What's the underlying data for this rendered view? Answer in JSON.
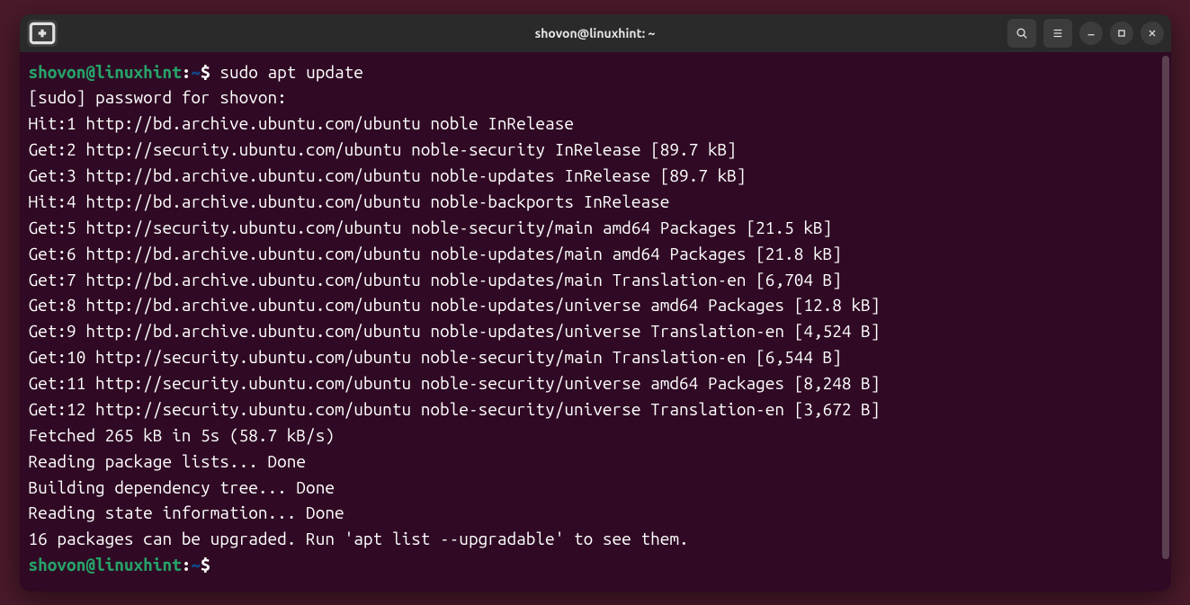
{
  "title": "shovon@linuxhint: ~",
  "prompt": {
    "user_host": "shovon@linuxhint",
    "colon": ":",
    "path": "~",
    "sep": "$"
  },
  "command": "sudo apt update",
  "output": [
    "[sudo] password for shovon:",
    "Hit:1 http://bd.archive.ubuntu.com/ubuntu noble InRelease",
    "Get:2 http://security.ubuntu.com/ubuntu noble-security InRelease [89.7 kB]",
    "Get:3 http://bd.archive.ubuntu.com/ubuntu noble-updates InRelease [89.7 kB]",
    "Hit:4 http://bd.archive.ubuntu.com/ubuntu noble-backports InRelease",
    "Get:5 http://security.ubuntu.com/ubuntu noble-security/main amd64 Packages [21.5 kB]",
    "Get:6 http://bd.archive.ubuntu.com/ubuntu noble-updates/main amd64 Packages [21.8 kB]",
    "Get:7 http://bd.archive.ubuntu.com/ubuntu noble-updates/main Translation-en [6,704 B]",
    "Get:8 http://bd.archive.ubuntu.com/ubuntu noble-updates/universe amd64 Packages [12.8 kB]",
    "Get:9 http://bd.archive.ubuntu.com/ubuntu noble-updates/universe Translation-en [4,524 B]",
    "Get:10 http://security.ubuntu.com/ubuntu noble-security/main Translation-en [6,544 B]",
    "Get:11 http://security.ubuntu.com/ubuntu noble-security/universe amd64 Packages [8,248 B]",
    "Get:12 http://security.ubuntu.com/ubuntu noble-security/universe Translation-en [3,672 B]",
    "Fetched 265 kB in 5s (58.7 kB/s)",
    "Reading package lists... Done",
    "Building dependency tree... Done",
    "Reading state information... Done",
    "16 packages can be upgraded. Run 'apt list --upgradable' to see them."
  ]
}
